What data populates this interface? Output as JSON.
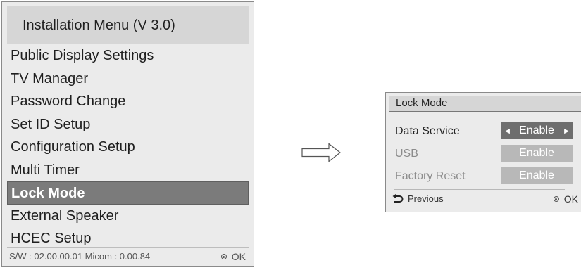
{
  "installation_menu": {
    "title": "Installation Menu (V 3.0)",
    "items": [
      {
        "label": "Public Display Settings",
        "selected": false
      },
      {
        "label": "TV Manager",
        "selected": false
      },
      {
        "label": "Password Change",
        "selected": false
      },
      {
        "label": "Set ID Setup",
        "selected": false
      },
      {
        "label": "Configuration Setup",
        "selected": false
      },
      {
        "label": "Multi Timer",
        "selected": false
      },
      {
        "label": "Lock Mode",
        "selected": true
      },
      {
        "label": "External Speaker",
        "selected": false
      },
      {
        "label": "HCEC Setup",
        "selected": false
      }
    ],
    "footer": {
      "fw_info": "S/W : 02.00.00.01 Micom : 0.00.84",
      "ok_label": "OK"
    }
  },
  "flow_arrow": {
    "icon": "right-arrow-outline-icon"
  },
  "lock_mode": {
    "title": "Lock Mode",
    "rows": [
      {
        "label": "Data Service",
        "value": "Enable",
        "active": true,
        "enabled": true
      },
      {
        "label": "USB",
        "value": "Enable",
        "active": false,
        "enabled": false
      },
      {
        "label": "Factory Reset",
        "value": "Enable",
        "active": false,
        "enabled": false
      }
    ],
    "footer": {
      "previous_label": "Previous",
      "ok_label": "OK"
    }
  },
  "colors": {
    "panel_bg": "#ebebeb",
    "title_bg": "#d6d6d6",
    "selected_bg": "#7b7b7b",
    "active_value_bg": "#6e6e6e",
    "disabled_value_bg": "#b8b8b8"
  }
}
